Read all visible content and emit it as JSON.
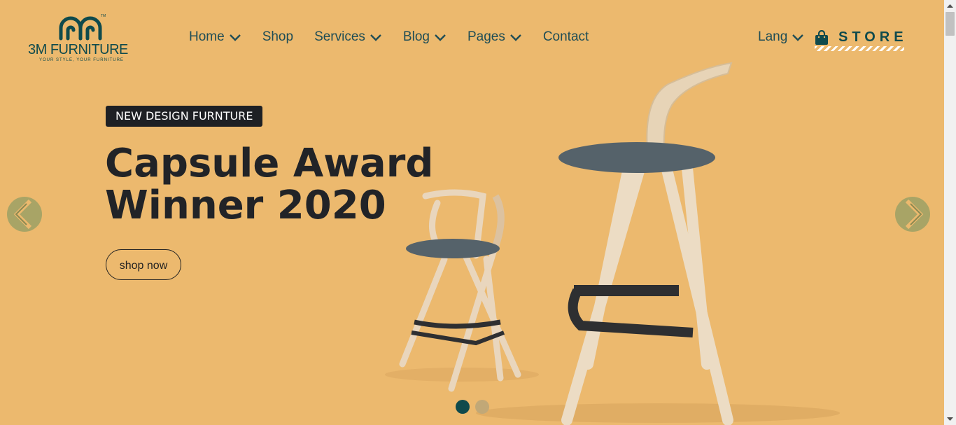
{
  "brand": {
    "name": "3M FURNITURE",
    "tagline": "YOUR STYLE, YOUR FURNITURE",
    "color": "#0f4a4c"
  },
  "nav": {
    "items": [
      {
        "label": "Home",
        "has_dropdown": true
      },
      {
        "label": "Shop",
        "has_dropdown": false
      },
      {
        "label": "Services",
        "has_dropdown": true
      },
      {
        "label": "Blog",
        "has_dropdown": true
      },
      {
        "label": "Pages",
        "has_dropdown": true
      },
      {
        "label": "Contact",
        "has_dropdown": false
      }
    ],
    "lang_label": "Lang",
    "store_label": "STORE",
    "store_icon": "shopping-bag-icon"
  },
  "hero": {
    "badge": "NEW DESIGN FURNTURE",
    "headline_line1": "Capsule Award",
    "headline_line2": "Winner 2020",
    "cta_label": "shop now",
    "background_color": "#ecb96e",
    "slide_count": 2,
    "active_slide": 1,
    "prev_icon": "chevron-left-icon",
    "next_icon": "chevron-right-icon"
  },
  "colors": {
    "accent": "#0f4a4c",
    "text_dark": "#212327",
    "arrow_bg": "#a8a466"
  }
}
